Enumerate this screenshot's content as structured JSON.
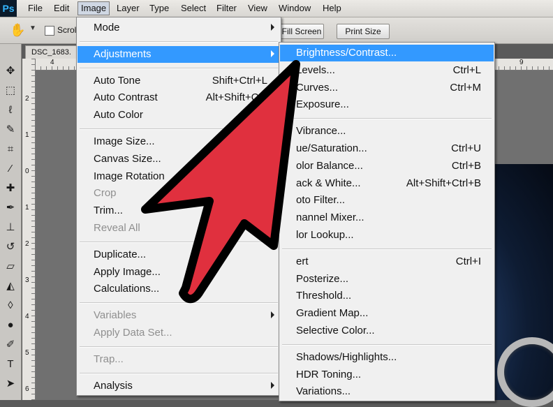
{
  "app": {
    "logo": "Ps"
  },
  "menubar": [
    "File",
    "Edit",
    "Image",
    "Layer",
    "Type",
    "Select",
    "Filter",
    "View",
    "Window",
    "Help"
  ],
  "options_bar": {
    "tool_icon": "hand-icon",
    "scroll_label": "Scrol",
    "fill_screen": "Fill Screen",
    "print_size": "Print Size"
  },
  "document": {
    "tab_title": "DSC_1683."
  },
  "rulers": {
    "top": [
      "4",
      "9"
    ],
    "left": [
      "2",
      "1",
      "0",
      "1",
      "2",
      "3",
      "4",
      "5",
      "6"
    ]
  },
  "image_menu": {
    "items": [
      {
        "label": "Mode",
        "submenu": true
      },
      {
        "separator": true
      },
      {
        "label": "Adjustments",
        "submenu": true,
        "highlighted": true
      },
      {
        "separator": true
      },
      {
        "label": "Auto Tone",
        "shortcut": "Shift+Ctrl+L"
      },
      {
        "label": "Auto Contrast",
        "shortcut": "Alt+Shift+Ctrl"
      },
      {
        "label": "Auto Color",
        "shortcut": "Shift+"
      },
      {
        "separator": true
      },
      {
        "label": "Image Size..."
      },
      {
        "label": "Canvas Size..."
      },
      {
        "label": "Image Rotation"
      },
      {
        "label": "Crop",
        "disabled": true
      },
      {
        "label": "Trim..."
      },
      {
        "label": "Reveal All",
        "disabled": true
      },
      {
        "separator": true
      },
      {
        "label": "Duplicate..."
      },
      {
        "label": "Apply Image..."
      },
      {
        "label": "Calculations..."
      },
      {
        "separator": true
      },
      {
        "label": "Variables",
        "submenu": true,
        "disabled": true
      },
      {
        "label": "Apply Data Set...",
        "disabled": true
      },
      {
        "separator": true
      },
      {
        "label": "Trap...",
        "disabled": true
      },
      {
        "separator": true
      },
      {
        "label": "Analysis",
        "submenu": true
      }
    ]
  },
  "adjustments_menu": {
    "items": [
      {
        "label": "Brightness/Contrast...",
        "highlighted": true
      },
      {
        "label": "Levels...",
        "shortcut": "Ctrl+L"
      },
      {
        "label": "Curves...",
        "shortcut": "Ctrl+M"
      },
      {
        "label": "Exposure..."
      },
      {
        "separator": true
      },
      {
        "label": "Vibrance..."
      },
      {
        "label": "ue/Saturation...",
        "shortcut": "Ctrl+U"
      },
      {
        "label": "olor Balance...",
        "shortcut": "Ctrl+B"
      },
      {
        "label": "ack & White...",
        "shortcut": "Alt+Shift+Ctrl+B"
      },
      {
        "label": "oto Filter..."
      },
      {
        "label": "nannel Mixer..."
      },
      {
        "label": "lor Lookup..."
      },
      {
        "separator": true
      },
      {
        "label": "ert",
        "shortcut": "Ctrl+I"
      },
      {
        "label": "Posterize..."
      },
      {
        "label": "Threshold..."
      },
      {
        "label": "Gradient Map..."
      },
      {
        "label": "Selective Color..."
      },
      {
        "separator": true
      },
      {
        "label": "Shadows/Highlights..."
      },
      {
        "label": "HDR Toning..."
      },
      {
        "label": "Variations..."
      }
    ]
  },
  "overlay": {
    "arrow_color": "#e0303e",
    "arrow_outline": "#000000"
  },
  "colors": {
    "highlight": "#3399ff",
    "menu_bg": "#f0f0f0"
  }
}
